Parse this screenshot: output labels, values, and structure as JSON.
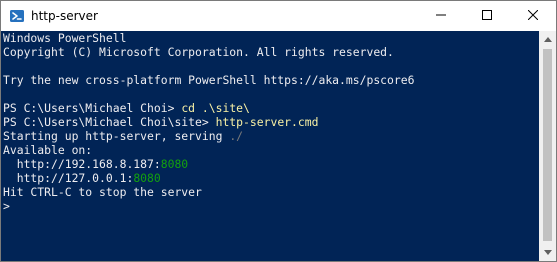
{
  "window": {
    "title": "http-server",
    "icon": "powershell-icon",
    "controls": [
      "minimize-icon",
      "maximize-icon",
      "close-icon"
    ]
  },
  "colors": {
    "console_bg": "#012456",
    "text": "#eeedf0",
    "command": "#f9f1a5",
    "dim": "#7a7a7a",
    "port": "#13a10e"
  },
  "console": {
    "header1": "Windows PowerShell",
    "header2": "Copyright (C) Microsoft Corporation. All rights reserved.",
    "tip": "Try the new cross-platform PowerShell https://aka.ms/pscore6",
    "prompt1": "PS C:\\Users\\Michael Choi> ",
    "command1": "cd .\\site\\",
    "prompt2": "PS C:\\Users\\Michael Choi\\site> ",
    "command2": "http-server.cmd",
    "starting": "Starting up http-server, serving ",
    "serving_path": "./",
    "available": "Available on:",
    "addr1_host": "  http://192.168.8.187:",
    "addr1_port": "8080",
    "addr2_host": "  http://127.0.0.1:",
    "addr2_port": "8080",
    "stop_hint": "Hit CTRL-C to stop the server",
    "cursor_prompt": ">"
  }
}
